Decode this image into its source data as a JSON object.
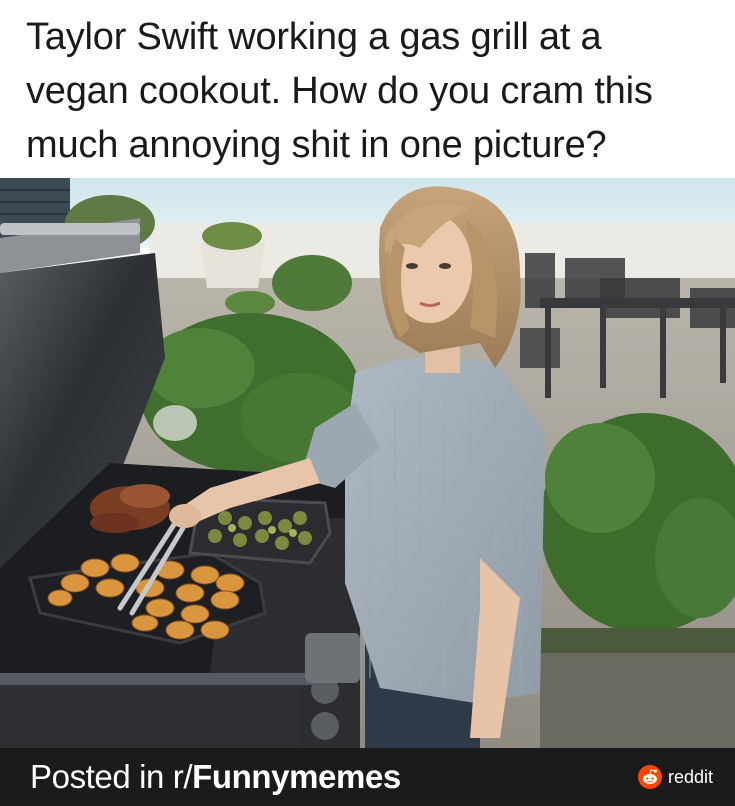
{
  "caption": {
    "line1": "Taylor Swift working a gas grill at a",
    "line2": "vegan cookout. How do you cram this",
    "line3": "much annoying shit in one picture?"
  },
  "footer": {
    "posted_prefix": "Posted in r/",
    "subreddit": "Funnymemes",
    "brand_name": "reddit",
    "brand_icon": "reddit-alien-icon",
    "brand_color": "#ff4500",
    "bar_color": "#1b1b1b"
  },
  "photo": {
    "subject": "woman in grey striped shirt grilling at an outdoor gas grill",
    "items_on_grill": [
      "sliced sweet potato rounds",
      "brussels sprouts tray",
      "meat"
    ]
  }
}
